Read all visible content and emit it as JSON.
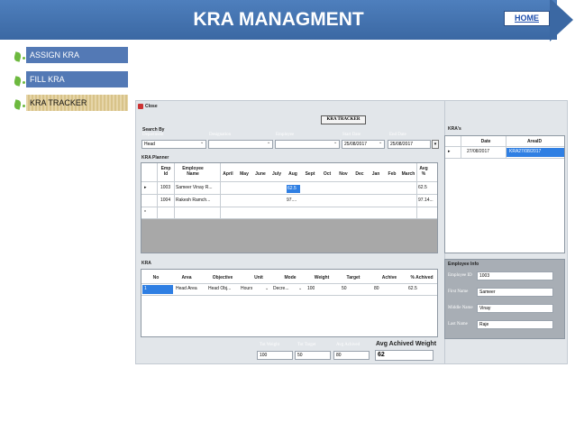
{
  "header": {
    "title": "KRA MANAGMENT",
    "home_label": "HOME"
  },
  "nav": {
    "items": [
      "ASSIGN KRA",
      "FILL KRA",
      "KRA TRACKER"
    ]
  },
  "window": {
    "close_label": "Close",
    "form_title": "KRA TRACKER",
    "search_by": "Search By",
    "search_fields": {
      "department_label": "Department",
      "department_value": "Head",
      "designation_label": "Designation",
      "employee_label": "Employee",
      "start_date_label": "Start Date",
      "start_date_value": "25/08/2017",
      "end_date_label": "End Date",
      "end_date_value": "25/08/2017"
    },
    "kra_planner": {
      "title": "KRA Planner",
      "columns": [
        "Emp Id",
        "Employee Name",
        "April",
        "May",
        "June",
        "July",
        "Aug",
        "Sept",
        "Oct",
        "Nov",
        "Dec",
        "Jan",
        "Feb",
        "March",
        "Avg %"
      ],
      "rows": [
        {
          "emp_id": "1003",
          "name": "Sameer Vinay R...",
          "aug": "62.5",
          "avg": "62.5"
        },
        {
          "emp_id": "1004",
          "name": "Rakesh Ramch...",
          "aug": "97....",
          "avg": "97.14..."
        }
      ],
      "new_row_marker": "*"
    },
    "kras": {
      "title": "KRA's",
      "columns": [
        "Date",
        "AreaID"
      ],
      "rows": [
        {
          "date": "27/08/2017",
          "area_id": "KRA27/08/2017"
        }
      ]
    },
    "kra_detail": {
      "title": "KRA",
      "columns": [
        "No",
        "Area",
        "Objective",
        "Unit",
        "Mode",
        "Weight",
        "Target",
        "Achive",
        "% Achived"
      ],
      "rows": [
        {
          "no": "1",
          "area": "Head Area",
          "objective": "Head Obj...",
          "unit": "Hours",
          "mode": "Decre...",
          "weight": "100",
          "target": "50",
          "achive": "80",
          "pct": "62.5"
        }
      ]
    },
    "employee_info": {
      "title": "Employee Info",
      "id_label": "Employee ID",
      "id_value": "1003",
      "first_label": "First Name",
      "first_value": "Sameer",
      "middle_label": "Middle Name",
      "middle_value": "Vinay",
      "last_label": "Last Name",
      "last_value": "Raje"
    },
    "totals": {
      "weight_label": "Tot Weight",
      "weight_value": "100",
      "target_label": "Tot Target",
      "target_value": "50",
      "achived_label": "Avg Achived",
      "achived_value": "80",
      "avg_label": "Avg Achived Weight",
      "avg_value": "62"
    }
  },
  "colors": {
    "banner": "#3b68a3",
    "nav": "#5379b5",
    "selection": "#2f7fe3",
    "leaf": "#6db93f"
  }
}
